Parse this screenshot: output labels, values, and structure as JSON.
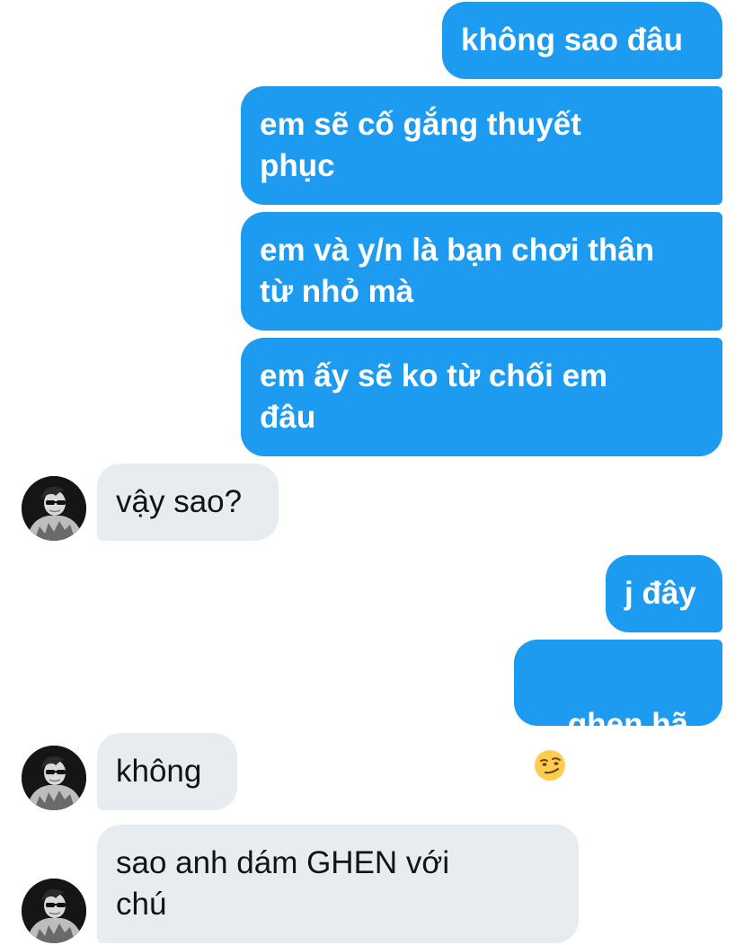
{
  "messages": [
    {
      "id": "m1",
      "side": "outgoing",
      "text": "không sao đâu"
    },
    {
      "id": "m2",
      "side": "outgoing",
      "text": "em sẽ cố gắng thuyết\nphục"
    },
    {
      "id": "m3",
      "side": "outgoing",
      "text": "em và y/n là bạn chơi thân\ntừ nhỏ mà"
    },
    {
      "id": "m4",
      "side": "outgoing",
      "text": "em ấy sẽ ko từ chối em\nđâu"
    },
    {
      "id": "m5",
      "side": "incoming",
      "text": "vậy sao?"
    },
    {
      "id": "m6",
      "side": "outgoing",
      "text": "j đây"
    },
    {
      "id": "m7",
      "side": "outgoing",
      "text": "ghen hã",
      "emoji": "smirking-face"
    },
    {
      "id": "m8",
      "side": "incoming",
      "text": "không"
    },
    {
      "id": "m9",
      "side": "incoming",
      "text": "sao anh dám GHEN với\nchú"
    }
  ],
  "colors": {
    "outgoing_bubble": "#1d9bf0",
    "incoming_bubble": "#e7ecf0",
    "outgoing_text": "#ffffff",
    "incoming_text": "#0f1419"
  }
}
